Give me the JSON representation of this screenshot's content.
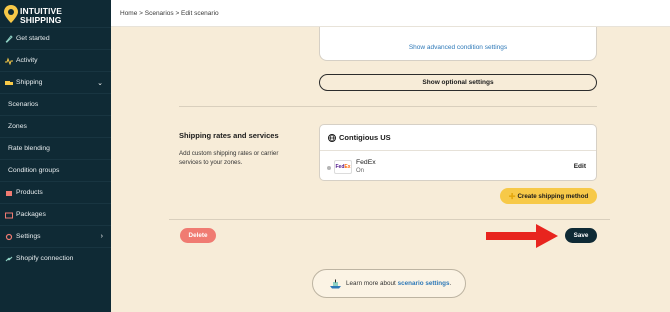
{
  "app": {
    "brand_line1": "INTUITIVE",
    "brand_line2": "SHIPPING"
  },
  "breadcrumb": "Home > Scenarios > Edit scenario",
  "sidebar": {
    "items": [
      {
        "label": "Get started",
        "icon": "rocket-icon"
      },
      {
        "label": "Activity",
        "icon": "activity-icon"
      },
      {
        "label": "Shipping",
        "icon": "truck-icon",
        "expanded": true
      },
      {
        "label": "Scenarios"
      },
      {
        "label": "Zones"
      },
      {
        "label": "Rate blending"
      },
      {
        "label": "Condition groups"
      },
      {
        "label": "Products",
        "icon": "box-icon"
      },
      {
        "label": "Packages",
        "icon": "package-icon"
      },
      {
        "label": "Settings",
        "icon": "gear-icon"
      },
      {
        "label": "Shopify connection",
        "icon": "link-icon"
      }
    ]
  },
  "main": {
    "advanced_link": "Show advanced condition settings",
    "optional_button": "Show optional settings",
    "section_title": "Shipping rates and services",
    "section_desc": "Add custom shipping rates or carrier services to your zones.",
    "zone_title": "Contigious US",
    "carrier": {
      "name": "FedEx",
      "status": "On",
      "logo_fe": "Fed",
      "logo_ex": "Ex"
    },
    "edit_label": "Edit",
    "create_label": "Create shipping method",
    "delete_label": "Delete",
    "save_label": "Save",
    "learn_text": "Learn more about ",
    "learn_link": "scenario settings",
    "learn_period": "."
  },
  "colors": {
    "sidebar_bg": "#0f2a35",
    "page_bg": "#f7ecd8",
    "link": "#2e79b8",
    "delete": "#f07b72",
    "accent_yellow": "#f7c948",
    "arrow_red": "#e8241e"
  }
}
